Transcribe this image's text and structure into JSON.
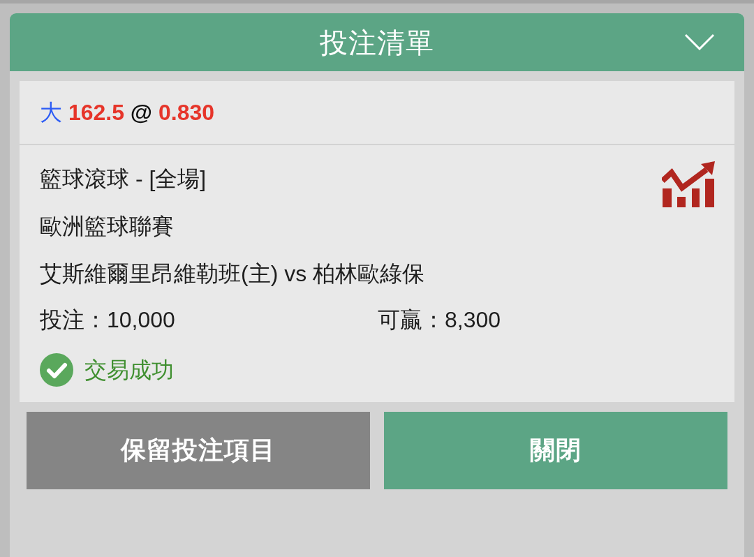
{
  "header": {
    "title": "投注清單"
  },
  "selection": {
    "parts": [
      {
        "text": "大",
        "kind": "side"
      },
      {
        "text": "162.5",
        "kind": "line"
      },
      {
        "text": "@",
        "kind": "separator"
      },
      {
        "text": "0.830",
        "kind": "odds"
      }
    ]
  },
  "bet": {
    "market": "籃球滾球 - [全場]",
    "league": "歐洲籃球聯賽",
    "match": "艾斯維爾里昂維勒班(主) vs 柏林歐綠保",
    "stake": "投注：10,000",
    "payout": "可贏：8,300"
  },
  "status": {
    "kind": "success",
    "text": "交易成功"
  },
  "buttons": [
    {
      "label": "保留投注項目",
      "kind": "secondary"
    },
    {
      "label": "關閉",
      "kind": "primary"
    }
  ]
}
